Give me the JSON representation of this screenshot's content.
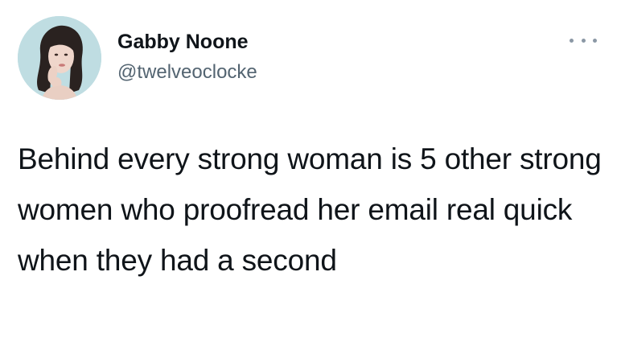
{
  "tweet": {
    "author": {
      "name": "Gabby Noone",
      "handle": "@twelveoclocke",
      "avatar_icon": "profile-photo"
    },
    "more_icon": "ellipsis-icon",
    "text": "Behind every strong woman is 5 other strong women who proofread her email real quick when they had a second"
  },
  "colors": {
    "text": "#0f1419",
    "secondary_text": "#536471",
    "more_icon": "#8b98a5",
    "avatar_background": "#b9d8dd"
  }
}
